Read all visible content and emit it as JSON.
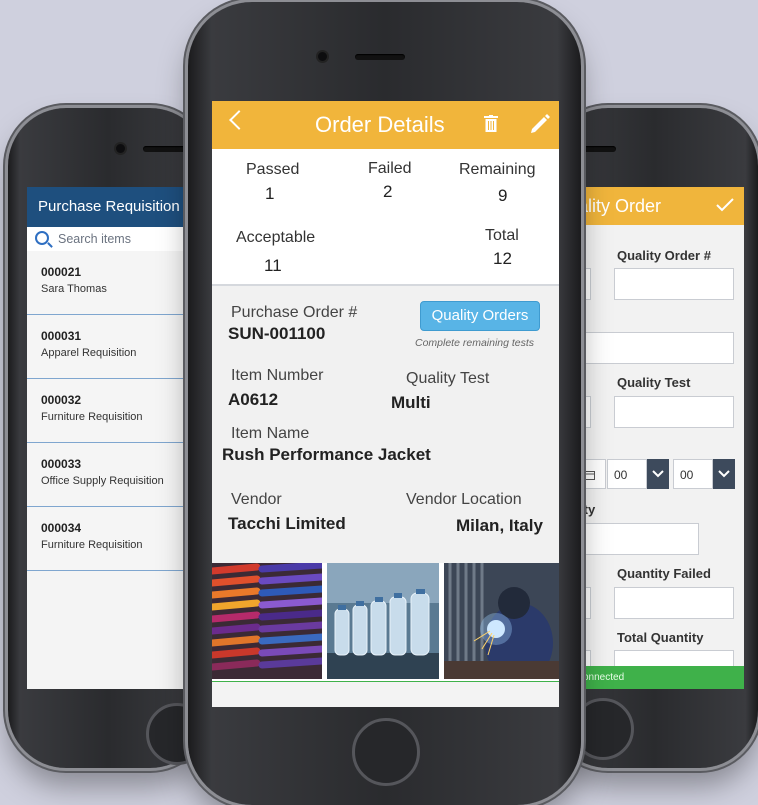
{
  "left_app": {
    "title": "Purchase Requisition",
    "search_placeholder": "Search items",
    "items": [
      {
        "number": "000021",
        "name": "Sara Thomas",
        "chevron": ""
      },
      {
        "number": "000031",
        "name": "Apparel Requisition",
        "chevron": "›"
      },
      {
        "number": "000032",
        "name": "Furniture Requisition",
        "chevron": "›"
      },
      {
        "number": "000033",
        "name": "Office Supply Requisition",
        "chevron": "›"
      },
      {
        "number": "000034",
        "name": "Furniture Requisition",
        "chevron": "›"
      }
    ]
  },
  "center_app": {
    "title": "Order Details",
    "stats": {
      "passed_label": "Passed",
      "passed_value": "1",
      "failed_label": "Failed",
      "failed_value": "2",
      "remaining_label": "Remaining",
      "remaining_value": "9",
      "acceptable_label": "Acceptable",
      "acceptable_value": "11",
      "total_label": "Total",
      "total_value": "12"
    },
    "details": {
      "po_label": "Purchase Order #",
      "po_value": "SUN-001100",
      "quality_orders_button": "Quality Orders",
      "quality_orders_note": "Complete remaining tests",
      "item_number_label": "Item Number",
      "item_number_value": "A0612",
      "quality_test_label": "Quality Test",
      "quality_test_value": "Multi",
      "item_name_label": "Item Name",
      "item_name_value": "Rush Performance Jacket",
      "vendor_label": "Vendor",
      "vendor_value": "Tacchi Limited",
      "vendor_location_label": "Vendor Location",
      "vendor_location_value": "Milan, Italy"
    },
    "photos": [
      "thread-spools-photo",
      "bottling-line-photo",
      "welder-photo"
    ]
  },
  "right_app": {
    "title": "ality Order",
    "quality_order_label": "Quality Order #",
    "quality_test_label": "Quality Test",
    "hour_value": "00",
    "minute_value": "00",
    "quantity_label": "ity",
    "quantity_failed_label": "Quantity Failed",
    "total_quantity_label": "Total Quantity",
    "status": "connected"
  },
  "colors": {
    "background": "#cfd0de",
    "left_header": "#1e4f7e",
    "accent_orange": "#f1b53b",
    "button_blue": "#58b4e6",
    "status_green": "#3fb14a"
  }
}
